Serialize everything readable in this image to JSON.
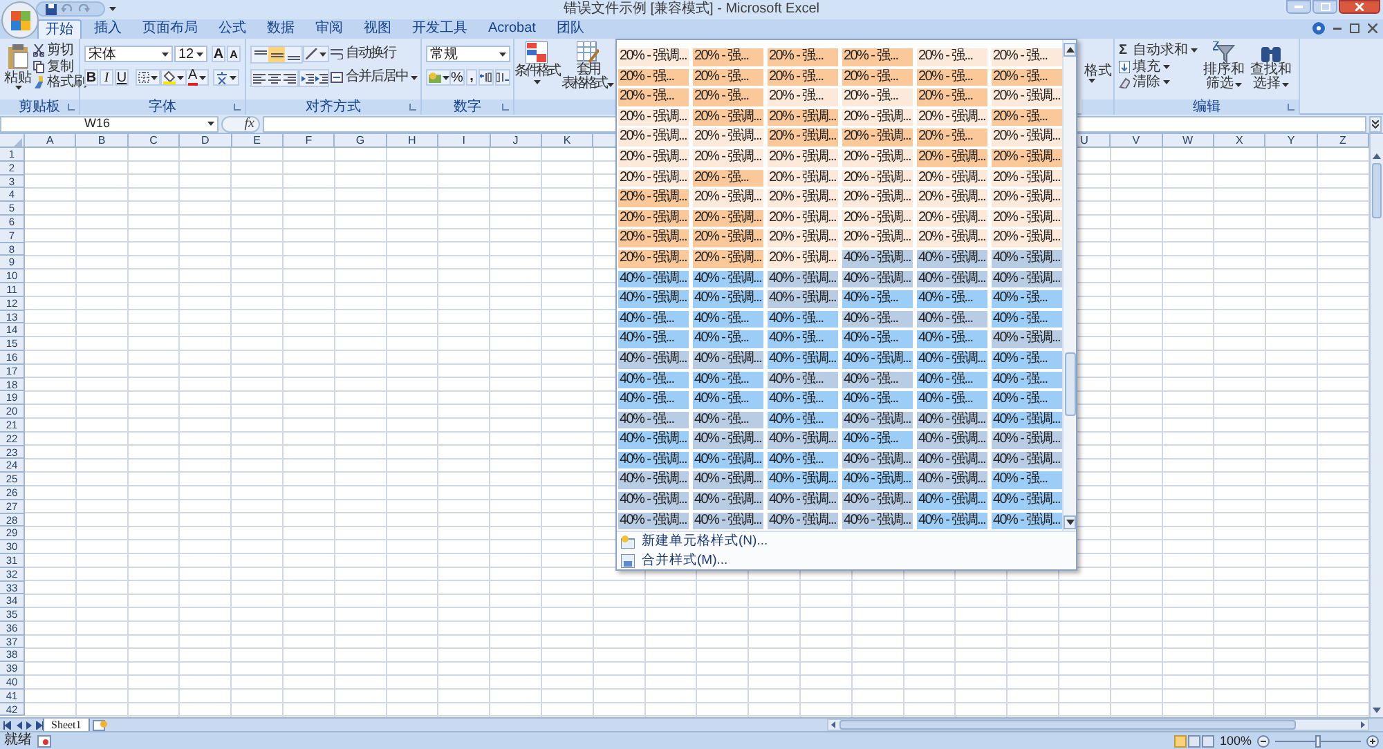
{
  "title_bar": {
    "title": "错误文件示例 [兼容模式] - Microsoft Excel"
  },
  "tabs": [
    {
      "label": "开始",
      "selected": true
    },
    {
      "label": "插入",
      "selected": false
    },
    {
      "label": "页面布局",
      "selected": false
    },
    {
      "label": "公式",
      "selected": false
    },
    {
      "label": "数据",
      "selected": false
    },
    {
      "label": "审阅",
      "selected": false
    },
    {
      "label": "视图",
      "selected": false
    },
    {
      "label": "开发工具",
      "selected": false
    },
    {
      "label": "Acrobat",
      "selected": false
    },
    {
      "label": "团队",
      "selected": false
    }
  ],
  "ribbon": {
    "clipboard": {
      "label": "剪贴板",
      "paste": "粘贴",
      "items": [
        "剪切",
        "复制",
        "格式刷"
      ]
    },
    "font": {
      "label": "字体",
      "font_name": "宋体",
      "font_size": "12",
      "grow": "A",
      "shrink": "A",
      "bold": "B",
      "italic": "I",
      "underline": "U",
      "font_color": "A"
    },
    "alignment": {
      "label": "对齐方式",
      "wrap_text": "自动换行",
      "merge_center": "合并后居中"
    },
    "number": {
      "label": "数字",
      "format": "常规",
      "percent": "%",
      "comma": ","
    },
    "styles": {
      "conditional_format": "条件格式",
      "table_format": [
        "套用",
        "表格格式"
      ]
    },
    "cells": {
      "format": "格式"
    },
    "editing": {
      "label": "编辑",
      "autosum_symbol": "Σ",
      "items": [
        "自动求和",
        "填充",
        "清除"
      ],
      "sort_filter": [
        "排序和",
        "筛选"
      ],
      "find_select": [
        "查找和",
        "选择"
      ]
    }
  },
  "formula_bar": {
    "name_box": "W16",
    "fx": "fx"
  },
  "sheet": {
    "columns_left": [
      "A",
      "B",
      "C",
      "D",
      "E",
      "F",
      "G",
      "H",
      "I",
      "J",
      "K"
    ],
    "columns_right": [
      "U",
      "V",
      "W",
      "X",
      "Y",
      "Z"
    ],
    "rows": [
      "1",
      "2",
      "3",
      "4",
      "5",
      "6",
      "7",
      "8",
      "9",
      "10",
      "11",
      "12",
      "13",
      "14",
      "15",
      "16",
      "17",
      "18",
      "19",
      "20",
      "21",
      "22",
      "23",
      "24",
      "25",
      "26",
      "27",
      "28",
      "29",
      "30",
      "31",
      "32",
      "33",
      "34",
      "35",
      "36",
      "37",
      "38",
      "39",
      "40",
      "41",
      "42"
    ]
  },
  "style_gallery": {
    "rows": [
      [
        {
          "text": "20% - 强调...",
          "color": "#fde9d9"
        },
        {
          "text": "20% - 强...",
          "color": "#fbc899"
        },
        {
          "text": "20% - 强...",
          "color": "#fbc899"
        },
        {
          "text": "20% - 强...",
          "color": "#fbc899"
        },
        {
          "text": "20% - 强...",
          "color": "#fde9d9"
        },
        {
          "text": "20% - 强...",
          "color": "#fde9d9"
        }
      ],
      [
        {
          "text": "20% - 强...",
          "color": "#fbc899"
        },
        {
          "text": "20% - 强...",
          "color": "#fbc899"
        },
        {
          "text": "20% - 强...",
          "color": "#fbc899"
        },
        {
          "text": "20% - 强...",
          "color": "#fbc899"
        },
        {
          "text": "20% - 强...",
          "color": "#fbc899"
        },
        {
          "text": "20% - 强...",
          "color": "#fbc899"
        }
      ],
      [
        {
          "text": "20% - 强...",
          "color": "#fbc899"
        },
        {
          "text": "20% - 强...",
          "color": "#fbc899"
        },
        {
          "text": "20% - 强...",
          "color": "#fde9d9"
        },
        {
          "text": "20% - 强...",
          "color": "#fde9d9"
        },
        {
          "text": "20% - 强...",
          "color": "#fbc899"
        },
        {
          "text": "20% - 强调...",
          "color": "#fde9d9"
        }
      ],
      [
        {
          "text": "20% - 强调...",
          "color": "#fde9d9"
        },
        {
          "text": "20% - 强调...",
          "color": "#fbc899"
        },
        {
          "text": "20% - 强调...",
          "color": "#fbc899"
        },
        {
          "text": "20% - 强调...",
          "color": "#fde9d9"
        },
        {
          "text": "20% - 强调...",
          "color": "#fde9d9"
        },
        {
          "text": "20% - 强...",
          "color": "#fbc899"
        }
      ],
      [
        {
          "text": "20% - 强调...",
          "color": "#fde9d9"
        },
        {
          "text": "20% - 强调...",
          "color": "#fde9d9"
        },
        {
          "text": "20% - 强调...",
          "color": "#fbc899"
        },
        {
          "text": "20% - 强调...",
          "color": "#fbc899"
        },
        {
          "text": "20% - 强...",
          "color": "#fbc899"
        },
        {
          "text": "20% - 强调...",
          "color": "#fde9d9"
        }
      ],
      [
        {
          "text": "20% - 强调...",
          "color": "#fde9d9"
        },
        {
          "text": "20% - 强调...",
          "color": "#fde9d9"
        },
        {
          "text": "20% - 强调...",
          "color": "#fde9d9"
        },
        {
          "text": "20% - 强调...",
          "color": "#fde9d9"
        },
        {
          "text": "20% - 强调...",
          "color": "#fbc899"
        },
        {
          "text": "20% - 强调...",
          "color": "#fbc899"
        }
      ],
      [
        {
          "text": "20% - 强调...",
          "color": "#fde9d9"
        },
        {
          "text": "20% - 强...",
          "color": "#fbc899"
        },
        {
          "text": "20% - 强调...",
          "color": "#fde9d9"
        },
        {
          "text": "20% - 强调...",
          "color": "#fde9d9"
        },
        {
          "text": "20% - 强调...",
          "color": "#fde9d9"
        },
        {
          "text": "20% - 强调...",
          "color": "#fde9d9"
        }
      ],
      [
        {
          "text": "20% - 强调...",
          "color": "#fbc899"
        },
        {
          "text": "20% - 强调...",
          "color": "#fde9d9"
        },
        {
          "text": "20% - 强调...",
          "color": "#fde9d9"
        },
        {
          "text": "20% - 强调...",
          "color": "#fde9d9"
        },
        {
          "text": "20% - 强调...",
          "color": "#fde9d9"
        },
        {
          "text": "20% - 强调...",
          "color": "#fde9d9"
        }
      ],
      [
        {
          "text": "20% - 强调...",
          "color": "#fbc899"
        },
        {
          "text": "20% - 强调...",
          "color": "#fbc899"
        },
        {
          "text": "20% - 强调...",
          "color": "#fde9d9"
        },
        {
          "text": "20% - 强调...",
          "color": "#fde9d9"
        },
        {
          "text": "20% - 强调...",
          "color": "#fde9d9"
        },
        {
          "text": "20% - 强调...",
          "color": "#fde9d9"
        }
      ],
      [
        {
          "text": "20% - 强调...",
          "color": "#fbc899"
        },
        {
          "text": "20% - 强调...",
          "color": "#fbc899"
        },
        {
          "text": "20% - 强调...",
          "color": "#fde9d9"
        },
        {
          "text": "20% - 强调...",
          "color": "#fde9d9"
        },
        {
          "text": "20% - 强调...",
          "color": "#fde9d9"
        },
        {
          "text": "20% - 强调...",
          "color": "#fde9d9"
        }
      ],
      [
        {
          "text": "20% - 强调...",
          "color": "#fbc899"
        },
        {
          "text": "20% - 强调...",
          "color": "#fbc899"
        },
        {
          "text": "20% - 强调...",
          "color": "#fde9d9"
        },
        {
          "text": "40% - 强调...",
          "color": "#b8cce4"
        },
        {
          "text": "40% - 强调...",
          "color": "#b8cce4"
        },
        {
          "text": "40% - 强调...",
          "color": "#b8cce4"
        }
      ],
      [
        {
          "text": "40% - 强调...",
          "color": "#9bcdf7"
        },
        {
          "text": "40% - 强调...",
          "color": "#9bcdf7"
        },
        {
          "text": "40% - 强调...",
          "color": "#b8cce4"
        },
        {
          "text": "40% - 强调...",
          "color": "#b8cce4"
        },
        {
          "text": "40% - 强调...",
          "color": "#b8cce4"
        },
        {
          "text": "40% - 强调...",
          "color": "#b8cce4"
        }
      ],
      [
        {
          "text": "40% - 强调...",
          "color": "#9bcdf7"
        },
        {
          "text": "40% - 强调...",
          "color": "#9bcdf7"
        },
        {
          "text": "40% - 强调...",
          "color": "#b8cce4"
        },
        {
          "text": "40% - 强...",
          "color": "#9bcdf7"
        },
        {
          "text": "40% - 强...",
          "color": "#9bcdf7"
        },
        {
          "text": "40% - 强...",
          "color": "#9bcdf7"
        }
      ],
      [
        {
          "text": "40% - 强...",
          "color": "#9bcdf7"
        },
        {
          "text": "40% - 强...",
          "color": "#9bcdf7"
        },
        {
          "text": "40% - 强...",
          "color": "#9bcdf7"
        },
        {
          "text": "40% - 强...",
          "color": "#b8cce4"
        },
        {
          "text": "40% - 强...",
          "color": "#b8cce4"
        },
        {
          "text": "40% - 强...",
          "color": "#9bcdf7"
        }
      ],
      [
        {
          "text": "40% - 强...",
          "color": "#9bcdf7"
        },
        {
          "text": "40% - 强...",
          "color": "#9bcdf7"
        },
        {
          "text": "40% - 强...",
          "color": "#9bcdf7"
        },
        {
          "text": "40% - 强...",
          "color": "#9bcdf7"
        },
        {
          "text": "40% - 强...",
          "color": "#9bcdf7"
        },
        {
          "text": "40% - 强调...",
          "color": "#b8cce4"
        }
      ],
      [
        {
          "text": "40% - 强调...",
          "color": "#b8cce4"
        },
        {
          "text": "40% - 强调...",
          "color": "#b8cce4"
        },
        {
          "text": "40% - 强调...",
          "color": "#9bcdf7"
        },
        {
          "text": "40% - 强调...",
          "color": "#9bcdf7"
        },
        {
          "text": "40% - 强调...",
          "color": "#9bcdf7"
        },
        {
          "text": "40% - 强...",
          "color": "#9bcdf7"
        }
      ],
      [
        {
          "text": "40% - 强...",
          "color": "#9bcdf7"
        },
        {
          "text": "40% - 强...",
          "color": "#9bcdf7"
        },
        {
          "text": "40% - 强...",
          "color": "#b8cce4"
        },
        {
          "text": "40% - 强...",
          "color": "#b8cce4"
        },
        {
          "text": "40% - 强...",
          "color": "#9bcdf7"
        },
        {
          "text": "40% - 强...",
          "color": "#9bcdf7"
        }
      ],
      [
        {
          "text": "40% - 强...",
          "color": "#9bcdf7"
        },
        {
          "text": "40% - 强...",
          "color": "#9bcdf7"
        },
        {
          "text": "40% - 强...",
          "color": "#9bcdf7"
        },
        {
          "text": "40% - 强...",
          "color": "#9bcdf7"
        },
        {
          "text": "40% - 强...",
          "color": "#9bcdf7"
        },
        {
          "text": "40% - 强...",
          "color": "#9bcdf7"
        }
      ],
      [
        {
          "text": "40% - 强...",
          "color": "#b8cce4"
        },
        {
          "text": "40% - 强...",
          "color": "#b8cce4"
        },
        {
          "text": "40% - 强...",
          "color": "#9bcdf7"
        },
        {
          "text": "40% - 强调...",
          "color": "#b8cce4"
        },
        {
          "text": "40% - 强调...",
          "color": "#b8cce4"
        },
        {
          "text": "40% - 强调...",
          "color": "#9bcdf7"
        }
      ],
      [
        {
          "text": "40% - 强调...",
          "color": "#9bcdf7"
        },
        {
          "text": "40% - 强调...",
          "color": "#b8cce4"
        },
        {
          "text": "40% - 强调...",
          "color": "#b8cce4"
        },
        {
          "text": "40% - 强...",
          "color": "#9bcdf7"
        },
        {
          "text": "40% - 强调...",
          "color": "#b8cce4"
        },
        {
          "text": "40% - 强调...",
          "color": "#b8cce4"
        }
      ],
      [
        {
          "text": "40% - 强调...",
          "color": "#9bcdf7"
        },
        {
          "text": "40% - 强调...",
          "color": "#9bcdf7"
        },
        {
          "text": "40% - 强...",
          "color": "#9bcdf7"
        },
        {
          "text": "40% - 强调...",
          "color": "#b8cce4"
        },
        {
          "text": "40% - 强调...",
          "color": "#b8cce4"
        },
        {
          "text": "40% - 强调...",
          "color": "#b8cce4"
        }
      ],
      [
        {
          "text": "40% - 强调...",
          "color": "#b8cce4"
        },
        {
          "text": "40% - 强调...",
          "color": "#b8cce4"
        },
        {
          "text": "40% - 强调...",
          "color": "#9bcdf7"
        },
        {
          "text": "40% - 强调...",
          "color": "#9bcdf7"
        },
        {
          "text": "40% - 强调...",
          "color": "#b8cce4"
        },
        {
          "text": "40% - 强...",
          "color": "#9bcdf7"
        }
      ],
      [
        {
          "text": "40% - 强调...",
          "color": "#b8cce4"
        },
        {
          "text": "40% - 强调...",
          "color": "#b8cce4"
        },
        {
          "text": "40% - 强调...",
          "color": "#b8cce4"
        },
        {
          "text": "40% - 强调...",
          "color": "#b8cce4"
        },
        {
          "text": "40% - 强调...",
          "color": "#9bcdf7"
        },
        {
          "text": "40% - 强调...",
          "color": "#9bcdf7"
        }
      ],
      [
        {
          "text": "40% - 强调...",
          "color": "#b8cce4"
        },
        {
          "text": "40% - 强调...",
          "color": "#b8cce4"
        },
        {
          "text": "40% - 强调...",
          "color": "#b8cce4"
        },
        {
          "text": "40% - 强调...",
          "color": "#b8cce4"
        },
        {
          "text": "40% - 强调...",
          "color": "#9bcdf7"
        },
        {
          "text": "40% - 强调...",
          "color": "#9bcdf7"
        }
      ]
    ],
    "menu": [
      "新建单元格样式(N)...",
      "合并样式(M)..."
    ]
  },
  "sheet_tabs": [
    {
      "label": "Sheet1",
      "selected": true
    }
  ],
  "status_bar": {
    "status": "就绪",
    "zoom": "100%",
    "zoom_slider": {
      "level": 0.5
    }
  }
}
